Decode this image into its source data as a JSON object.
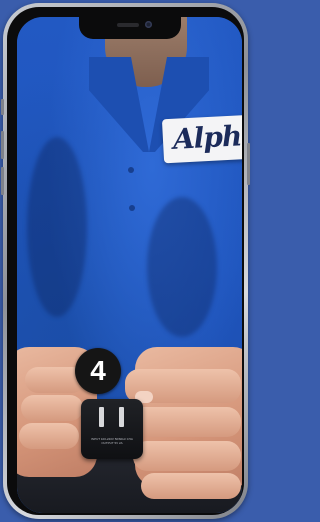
{
  "video": {
    "badge_text": "Alpha",
    "step_number": "4",
    "adapter_text": "INPUT 100-240V 50/60Hz 0.5A OUTPUT 5V 2A"
  },
  "colors": {
    "background": "#3a5dac",
    "shirt": "#1f55bd",
    "badge": "#f4f4f6",
    "step_badge": "#151515"
  },
  "icons": {
    "camera": "front-camera-icon",
    "speaker": "earpiece-speaker-icon"
  }
}
